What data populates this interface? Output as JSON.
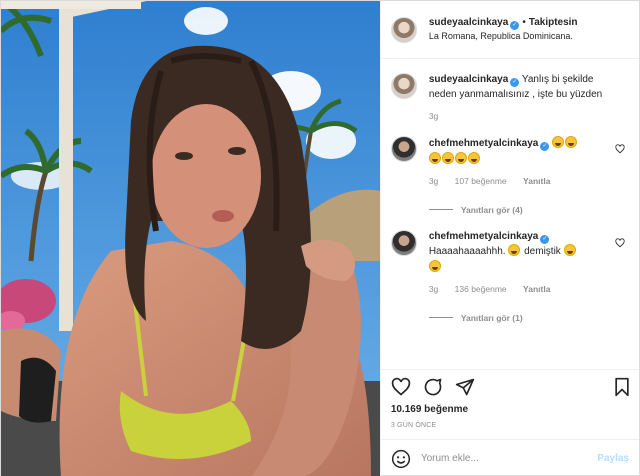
{
  "header": {
    "username": "sudeyaalcinkaya",
    "separator": "•",
    "follow_label": "Takiptesin",
    "location": "La Romana, Republica Dominicana."
  },
  "caption": {
    "username": "sudeyaalcinkaya",
    "text": "Yanlış bi şekilde neden yanmamalısınız , işte bu yüzden",
    "time": "3g"
  },
  "comments": [
    {
      "username": "chefmehmetyalcinkaya",
      "text": "",
      "emoji_count": 6,
      "time": "3g",
      "likes": "107 beğenme",
      "reply_label": "Yanıtla",
      "view_replies": "Yanıtları gör (4)"
    },
    {
      "username": "chefmehmetyalcinkaya",
      "text": "Haaaahaaaahhh.",
      "text2": "demiştik",
      "time": "3g",
      "likes": "136 beğenme",
      "reply_label": "Yanıtla",
      "view_replies": "Yanıtları gör (1)"
    }
  ],
  "actions": {
    "icons": [
      "heart-icon",
      "comment-icon",
      "share-icon",
      "bookmark-icon"
    ]
  },
  "likes_count": "10.169 beğenme",
  "date": "3 GÜN ÖNCE",
  "comment_box": {
    "placeholder": "Yorum ekle...",
    "post_label": "Paylaş"
  },
  "colors": {
    "verified": "#3897f0",
    "secondary_text": "#8e8e8e",
    "post_disabled": "#b2dffc"
  }
}
